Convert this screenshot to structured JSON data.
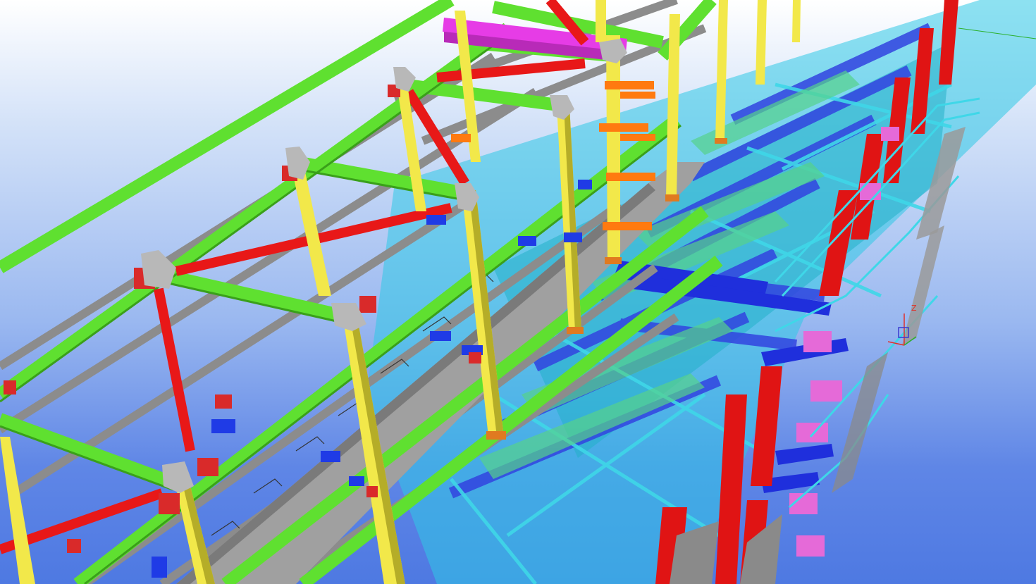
{
  "viewer": {
    "axis_label_z": "Z"
  },
  "colors": {
    "sky_top": "#ffffff",
    "sky_bottom": "#4e79e2",
    "column": "#f2e84a",
    "column_dark": "#b5ad28",
    "girt": "#5fe030",
    "girt_dark": "#3aa01a",
    "purlin_grey": "#8c8c8c",
    "bracing": "#e81818",
    "magenta": "#e63ce6",
    "orange": "#ff7a10",
    "blue_member": "#1f3be6",
    "cyan": "#2fc8e6",
    "teal": "#23a9b8",
    "walkway_grey": "#9a9a9a",
    "red_column": "#e01414",
    "pink_plate": "#e56ad8"
  }
}
